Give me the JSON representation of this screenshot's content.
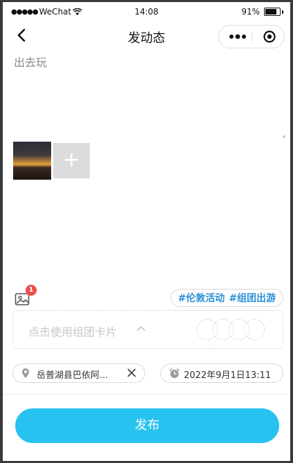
{
  "status_bar": {
    "carrier": "WeChat",
    "time": "14:08",
    "battery": "91%",
    "battery_level": 0.91
  },
  "nav": {
    "title": "发动态",
    "back_icon": "chevron-left-icon",
    "more_icon": "more-dots-icon",
    "close_icon": "miniprogram-close-icon"
  },
  "post": {
    "text": "出去玩",
    "photos_count": 1,
    "add_photo_glyph": "+"
  },
  "tools": {
    "image_badge": "1",
    "tags": [
      "#伦敦活动",
      "#组团出游"
    ]
  },
  "team_card": {
    "label": "点击使用组团卡片"
  },
  "location": {
    "text": "岳普湖县巴依阿..."
  },
  "datetime": {
    "text": "2022年9月1日13:11"
  },
  "publish_button": {
    "label": "发布"
  },
  "colors": {
    "accent": "#27c2f0",
    "tag": "#2a8fd6",
    "badge": "#f04b4b"
  }
}
